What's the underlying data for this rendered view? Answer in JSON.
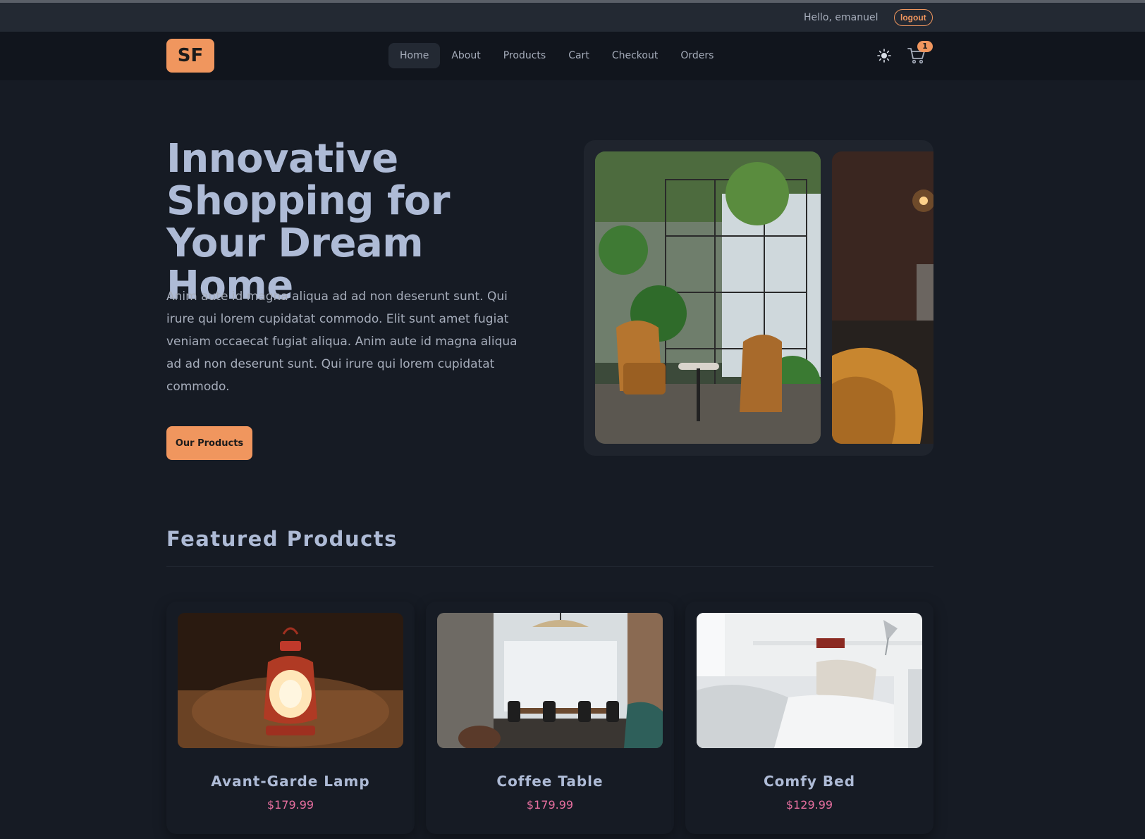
{
  "topbar": {
    "greeting": "Hello, emanuel",
    "logout_label": "logout"
  },
  "navbar": {
    "logo_text": "SF",
    "links": [
      {
        "label": "Home",
        "active": true
      },
      {
        "label": "About",
        "active": false
      },
      {
        "label": "Products",
        "active": false
      },
      {
        "label": "Cart",
        "active": false
      },
      {
        "label": "Checkout",
        "active": false
      },
      {
        "label": "Orders",
        "active": false
      }
    ],
    "theme_icon": "sun-icon",
    "cart_icon": "cart-icon",
    "cart_count": "1"
  },
  "hero": {
    "title": "Innovative Shopping for Your Dream Home",
    "text": "Anim aute id magna aliqua ad ad non deserunt sunt. Qui irure qui lorem cupidatat commodo. Elit sunt amet fugiat veniam occaecat fugiat aliqua. Anim aute id magna aliqua ad ad non deserunt sunt. Qui irure qui lorem cupidatat commodo.",
    "button_label": "Our Products"
  },
  "featured": {
    "title": "Featured Products",
    "products": [
      {
        "name": "Avant-Garde Lamp",
        "price": "$179.99"
      },
      {
        "name": "Coffee Table",
        "price": "$179.99"
      },
      {
        "name": "Comfy Bed",
        "price": "$129.99"
      }
    ]
  },
  "colors": {
    "accent": "#f0965e",
    "background": "#161b24",
    "price": "#e76f9f"
  }
}
